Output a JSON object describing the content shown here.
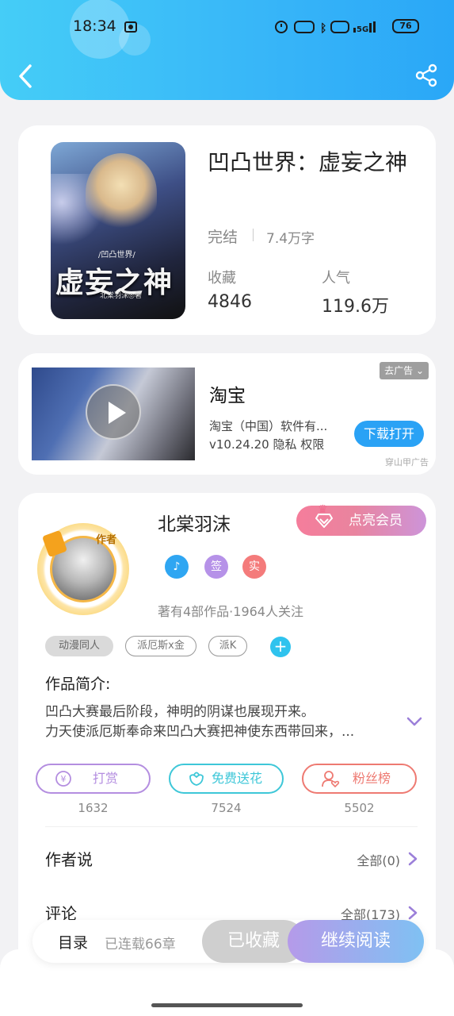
{
  "status_bar": {
    "time": "18:34",
    "icons": [
      "alarm-icon",
      "nfc-icon",
      "bluetooth-icon",
      "hd-icon",
      "signal-5g-icon"
    ],
    "battery": "76"
  },
  "header": {
    "back_icon": "chevron-left-icon",
    "share_icon": "share-icon",
    "colors": {
      "start": "#45cdf7",
      "end": "#2aa7f7"
    }
  },
  "book": {
    "cover_subtitle": "/凹凸世界/",
    "cover_title": "虚妄之神",
    "cover_author": "北棠羽沫◎著",
    "title": "凹凸世界：虚妄之神",
    "status": "完结",
    "word_count": "7.4万字",
    "favorites_label": "收藏",
    "favorites_value": "4846",
    "popularity_label": "人气",
    "popularity_value": "119.6万"
  },
  "ad": {
    "remove_ad": "去广告",
    "app_name": "淘宝",
    "company": "淘宝（中国）软件有...",
    "version_line": "v10.24.20  隐私  权限",
    "download_button": "下载打开",
    "source": "穿山甲广告"
  },
  "author": {
    "name": "北棠羽沫",
    "avatar_label": "作者",
    "vip_button": "点亮会员",
    "badges": [
      {
        "label": "♪",
        "color": "#2fa6f2"
      },
      {
        "label": "签",
        "color": "#b692e8"
      },
      {
        "label": "实",
        "color": "#f47b7b"
      }
    ],
    "info": "著有4部作品·1964人关注",
    "tags": [
      "动漫同人",
      "派厄斯x金",
      "派K"
    ]
  },
  "intro": {
    "title": "作品简介:",
    "line1": "凹凸大赛最后阶段，神明的阴谋也展现开来。",
    "line2": "力天使派厄斯奉命来凹凸大赛把神使东西带回来，..."
  },
  "actions": [
    {
      "label": "打赏",
      "count": "1632",
      "color": "#b48ee0",
      "icon": "yen-icon"
    },
    {
      "label": "免费送花",
      "count": "7524",
      "color": "#3ec7d8",
      "icon": "flower-icon"
    },
    {
      "label": "粉丝榜",
      "count": "5502",
      "color": "#ee7a72",
      "icon": "fan-rank-icon"
    }
  ],
  "author_says": {
    "title": "作者说",
    "right": "全部(0)"
  },
  "comments": {
    "title": "评论",
    "right": "全部(173)"
  },
  "bottom": {
    "toc": "目录",
    "chapters": "已连载66章",
    "collected": "已收藏",
    "continue": "继续阅读"
  }
}
